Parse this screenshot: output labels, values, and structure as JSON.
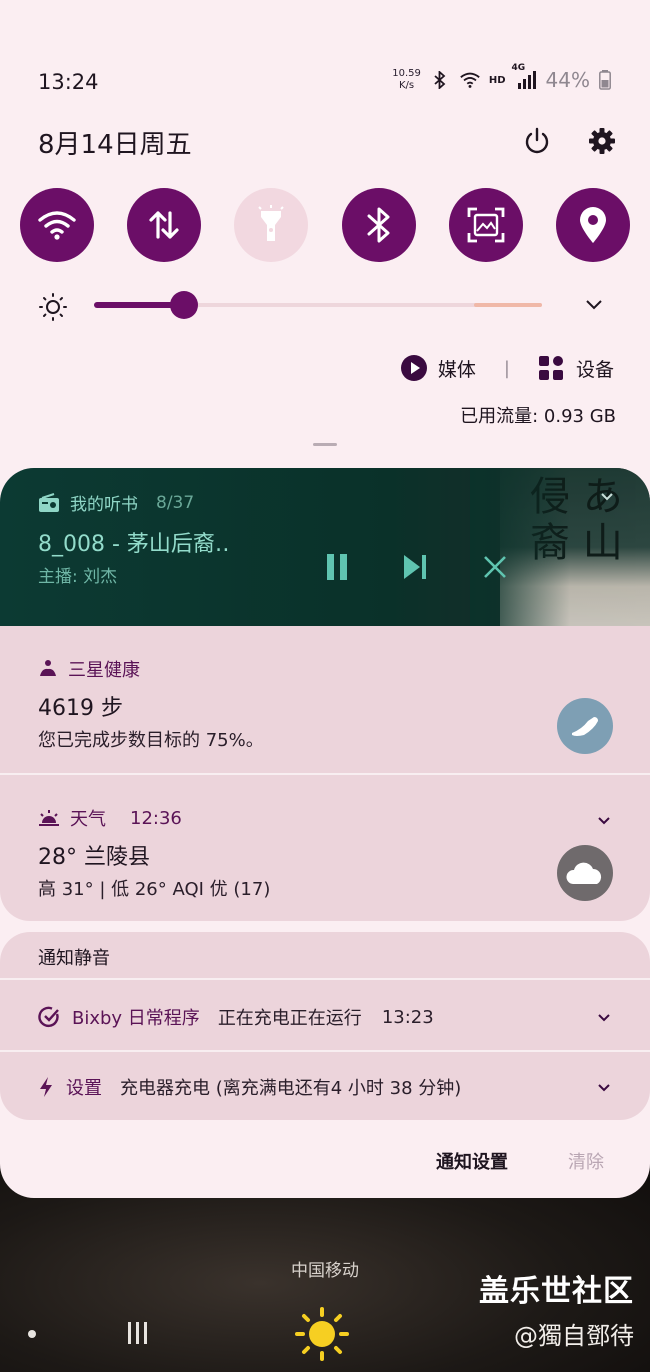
{
  "status_bar": {
    "time": "13:24",
    "net_speed_value": "10.59",
    "net_speed_unit": "K/s",
    "network_label": "HD",
    "network_gen": "4G",
    "battery": "44%"
  },
  "header": {
    "date": "8月14日周五",
    "power_icon": "power-icon",
    "settings_icon": "gear-icon"
  },
  "quick_settings": [
    {
      "name": "wifi",
      "icon": "wifi-icon",
      "active": true
    },
    {
      "name": "mobile-data",
      "icon": "data-transfer-icon",
      "active": true
    },
    {
      "name": "flashlight",
      "icon": "flashlight-icon",
      "active": false
    },
    {
      "name": "bluetooth",
      "icon": "bluetooth-icon",
      "active": true
    },
    {
      "name": "screenshot",
      "icon": "screenshot-icon",
      "active": true
    },
    {
      "name": "location",
      "icon": "location-pin-icon",
      "active": true
    }
  ],
  "brightness": {
    "level": 0.2
  },
  "media_output": {
    "media_label": "媒体",
    "devices_label": "设备"
  },
  "data_usage": "已用流量: 0.93 GB",
  "media_player": {
    "app_name": "我的听书",
    "track_count": "8/37",
    "title": "8_008 - 茅山后裔‥",
    "subtitle": "主播: 刘杰"
  },
  "notifications": [
    {
      "app": "三星健康",
      "title": "4619 步",
      "text": "您已完成步数目标的 75%。"
    },
    {
      "app": "天气",
      "time": "12:36",
      "title": "28° 兰陵县",
      "text": "高 31° | 低 26° AQI 优 (17)"
    }
  ],
  "silent": {
    "header": "通知静音",
    "items": [
      {
        "app": "Bixby 日常程序",
        "text": "正在充电正在运行",
        "time": "13:23"
      },
      {
        "app": "设置",
        "text": "充电器充电 (离充满电还有4 小时 38 分钟)"
      }
    ]
  },
  "actions": {
    "notification_settings": "通知设置",
    "clear": "清除"
  },
  "lockscreen": {
    "carrier": "中国移动"
  },
  "watermark": {
    "line1": "盖乐世社区",
    "line2": "@獨自鄧待"
  }
}
